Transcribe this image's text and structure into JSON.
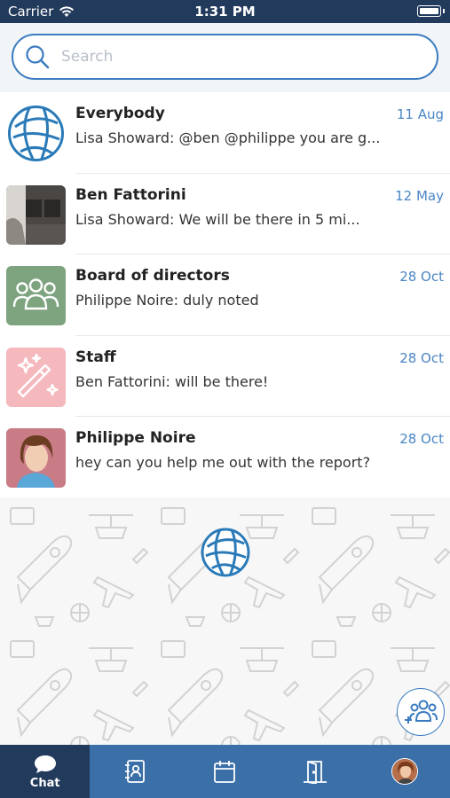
{
  "status_bar": {
    "carrier": "Carrier",
    "time": "1:31 PM"
  },
  "search": {
    "placeholder": "Search",
    "value": ""
  },
  "chats": [
    {
      "title": "Everybody",
      "preview": "Lisa Showard: @ben @philippe you are g...",
      "date": "11 Aug",
      "avatar": "globe-icon"
    },
    {
      "title": "Ben Fattorini",
      "preview": "Lisa Showard: We will be there in 5 mi...",
      "date": "12 May",
      "avatar": "photo"
    },
    {
      "title": "Board of directors",
      "preview": "Philippe Noire: duly noted",
      "date": "28 Oct",
      "avatar": "group-icon",
      "avatar_color": "#7da37f"
    },
    {
      "title": "Staff",
      "preview": "Ben Fattorini: will be there!",
      "date": "28 Oct",
      "avatar": "magic-wand-icon",
      "avatar_color": "#f5b8bd"
    },
    {
      "title": "Philippe Noire",
      "preview": "hey can you help me out with the report?",
      "date": "28 Oct",
      "avatar": "photo"
    }
  ],
  "tabs": [
    {
      "label": "Chat",
      "icon": "chat-icon",
      "active": true
    },
    {
      "label": "",
      "icon": "contacts-icon",
      "active": false
    },
    {
      "label": "",
      "icon": "calendar-icon",
      "active": false
    },
    {
      "label": "",
      "icon": "door-icon",
      "active": false
    },
    {
      "label": "",
      "icon": "profile-avatar",
      "active": false
    }
  ],
  "colors": {
    "accent": "#3a7bc0",
    "date": "#4a86c5",
    "status_bar": "#223a5c",
    "tab_bar": "#3b6fa8",
    "tab_active": "#223a5c"
  }
}
